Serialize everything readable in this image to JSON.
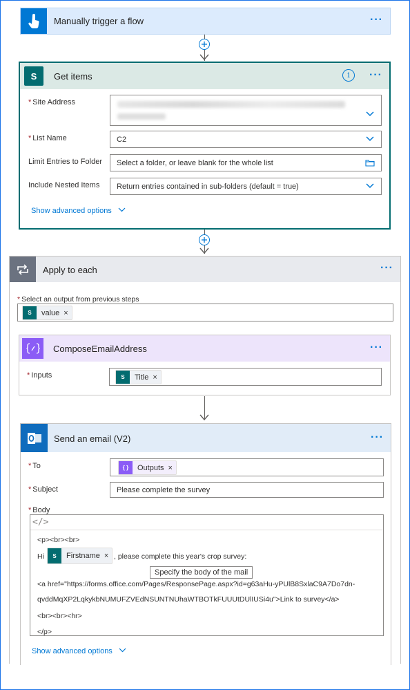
{
  "trigger": {
    "title": "Manually trigger a flow",
    "more": "···"
  },
  "get_items": {
    "title": "Get items",
    "more": "···",
    "info": "i",
    "sp_icon_letter": "S",
    "site_address_label": "Site Address",
    "list_name_label": "List Name",
    "list_name_value": "C2",
    "folder_label": "Limit Entries to Folder",
    "folder_placeholder": "Select a folder, or leave blank for the whole list",
    "nested_label": "Include Nested Items",
    "nested_value": "Return entries contained in sub-folders (default = true)",
    "advanced": "Show advanced options"
  },
  "apply_each": {
    "title": "Apply to each",
    "more": "···",
    "select_label": "Select an output from previous steps",
    "token_value": "value"
  },
  "compose": {
    "title": "ComposeEmailAddress",
    "more": "···",
    "inputs_label": "Inputs",
    "token_title": "Title"
  },
  "send_email": {
    "title": "Send an email (V2)",
    "more": "···",
    "to_label": "To",
    "to_token": "Outputs",
    "subject_label": "Subject",
    "subject_value": "Please complete the survey",
    "body_label": "Body",
    "code_toggle": "</>",
    "line1": "<p><br><br>",
    "line2_hi": "Hi",
    "firstname_token": "Firstname",
    "line2_rest": ", please complete this year's crop survey:",
    "line3": "<a href=\"https://forms.office.com/Pages/ResponsePage.aspx?id=g63aHu-yPUlB8SxlaC9A7Do7dn-",
    "line4": "qvddMqXP2LqkykbNUMUFZVEdNSUNTNUhaWTBOTkFUUUtDUlIUSi4u\">Link to survey</a>",
    "line5": "<br><br><hr>",
    "line6": "</p>",
    "tooltip": "Specify the body of the mail",
    "advanced": "Show advanced options"
  },
  "colors": {
    "trigger_bg": "#dcebfd",
    "trigger_icon": "#0078d4",
    "sharepoint_head": "#dbe9e5",
    "sharepoint_icon": "#036c70",
    "loop_head": "#e8eaee",
    "loop_icon": "#6b7280",
    "compose_head": "#ede4fb",
    "compose_icon": "#8b5cf6",
    "outlook_head": "#e1ecf8",
    "outlook_icon": "#0f6cbd"
  }
}
